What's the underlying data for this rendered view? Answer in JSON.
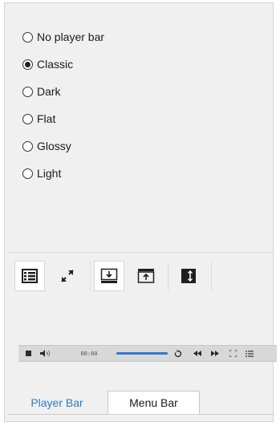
{
  "player_bar_options": {
    "items": [
      {
        "label": "No player bar",
        "checked": false
      },
      {
        "label": "Classic",
        "checked": true
      },
      {
        "label": "Dark",
        "checked": false
      },
      {
        "label": "Flat",
        "checked": false
      },
      {
        "label": "Glossy",
        "checked": false
      },
      {
        "label": "Light",
        "checked": false
      }
    ]
  },
  "layout_toolbar": {
    "buttons": [
      {
        "icon": "list-layout-icon",
        "selected": true
      },
      {
        "icon": "expand-arrows-icon",
        "selected": false
      },
      {
        "icon": "dock-bottom-icon",
        "selected": true
      },
      {
        "icon": "dock-top-icon",
        "selected": false
      },
      {
        "icon": "vertical-resize-icon",
        "selected": false
      }
    ]
  },
  "player_preview": {
    "time": "00:00",
    "progress": 1.0,
    "icons": [
      "stop-icon",
      "volume-icon",
      "repeat-icon",
      "rewind-icon",
      "fast-forward-icon",
      "fullscreen-icon",
      "playlist-icon"
    ],
    "accent_color": "#2f7ad1"
  },
  "tabs": [
    {
      "label": "Player Bar",
      "active": true,
      "color": "#2e7bc4"
    },
    {
      "label": "Menu Bar",
      "active": false
    }
  ]
}
